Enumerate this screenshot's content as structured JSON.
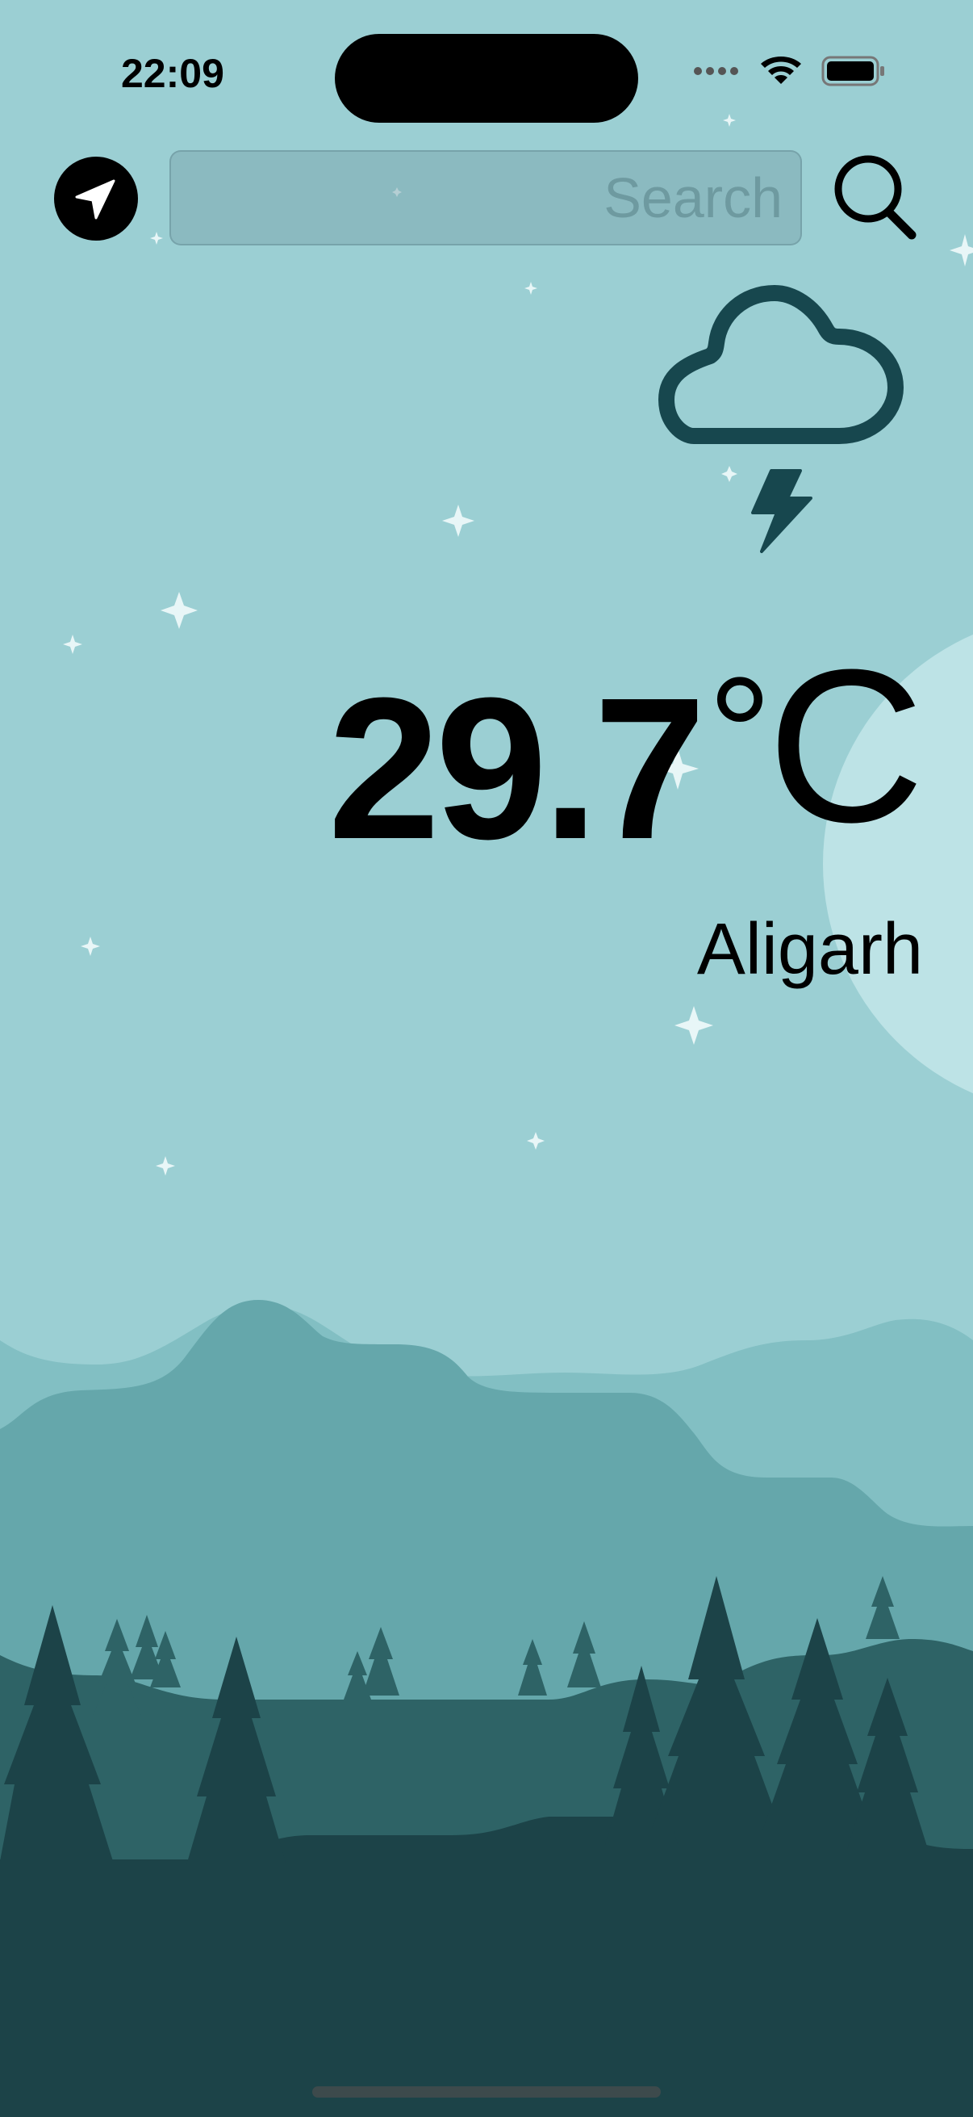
{
  "status_bar": {
    "time": "22:09",
    "icons": [
      "cellular-icon",
      "wifi-icon",
      "battery-icon"
    ]
  },
  "search": {
    "placeholder": "Search",
    "value": ""
  },
  "toolbar": {
    "location_icon": "location-arrow-icon",
    "search_icon": "magnifying-glass-icon"
  },
  "weather": {
    "condition_icon": "cloud-bolt-icon",
    "temperature": "29.7",
    "degree_symbol": "°",
    "unit": "C",
    "city": "Aligarh"
  },
  "colors": {
    "sky": "#9bcfd3",
    "moon": "#bde3e6",
    "far_hills": "#82bfc3",
    "mid_hills": "#65a7ab",
    "near_hills": "#2e6366",
    "foreground": "#1c4348",
    "icon_accent": "#17474e"
  }
}
